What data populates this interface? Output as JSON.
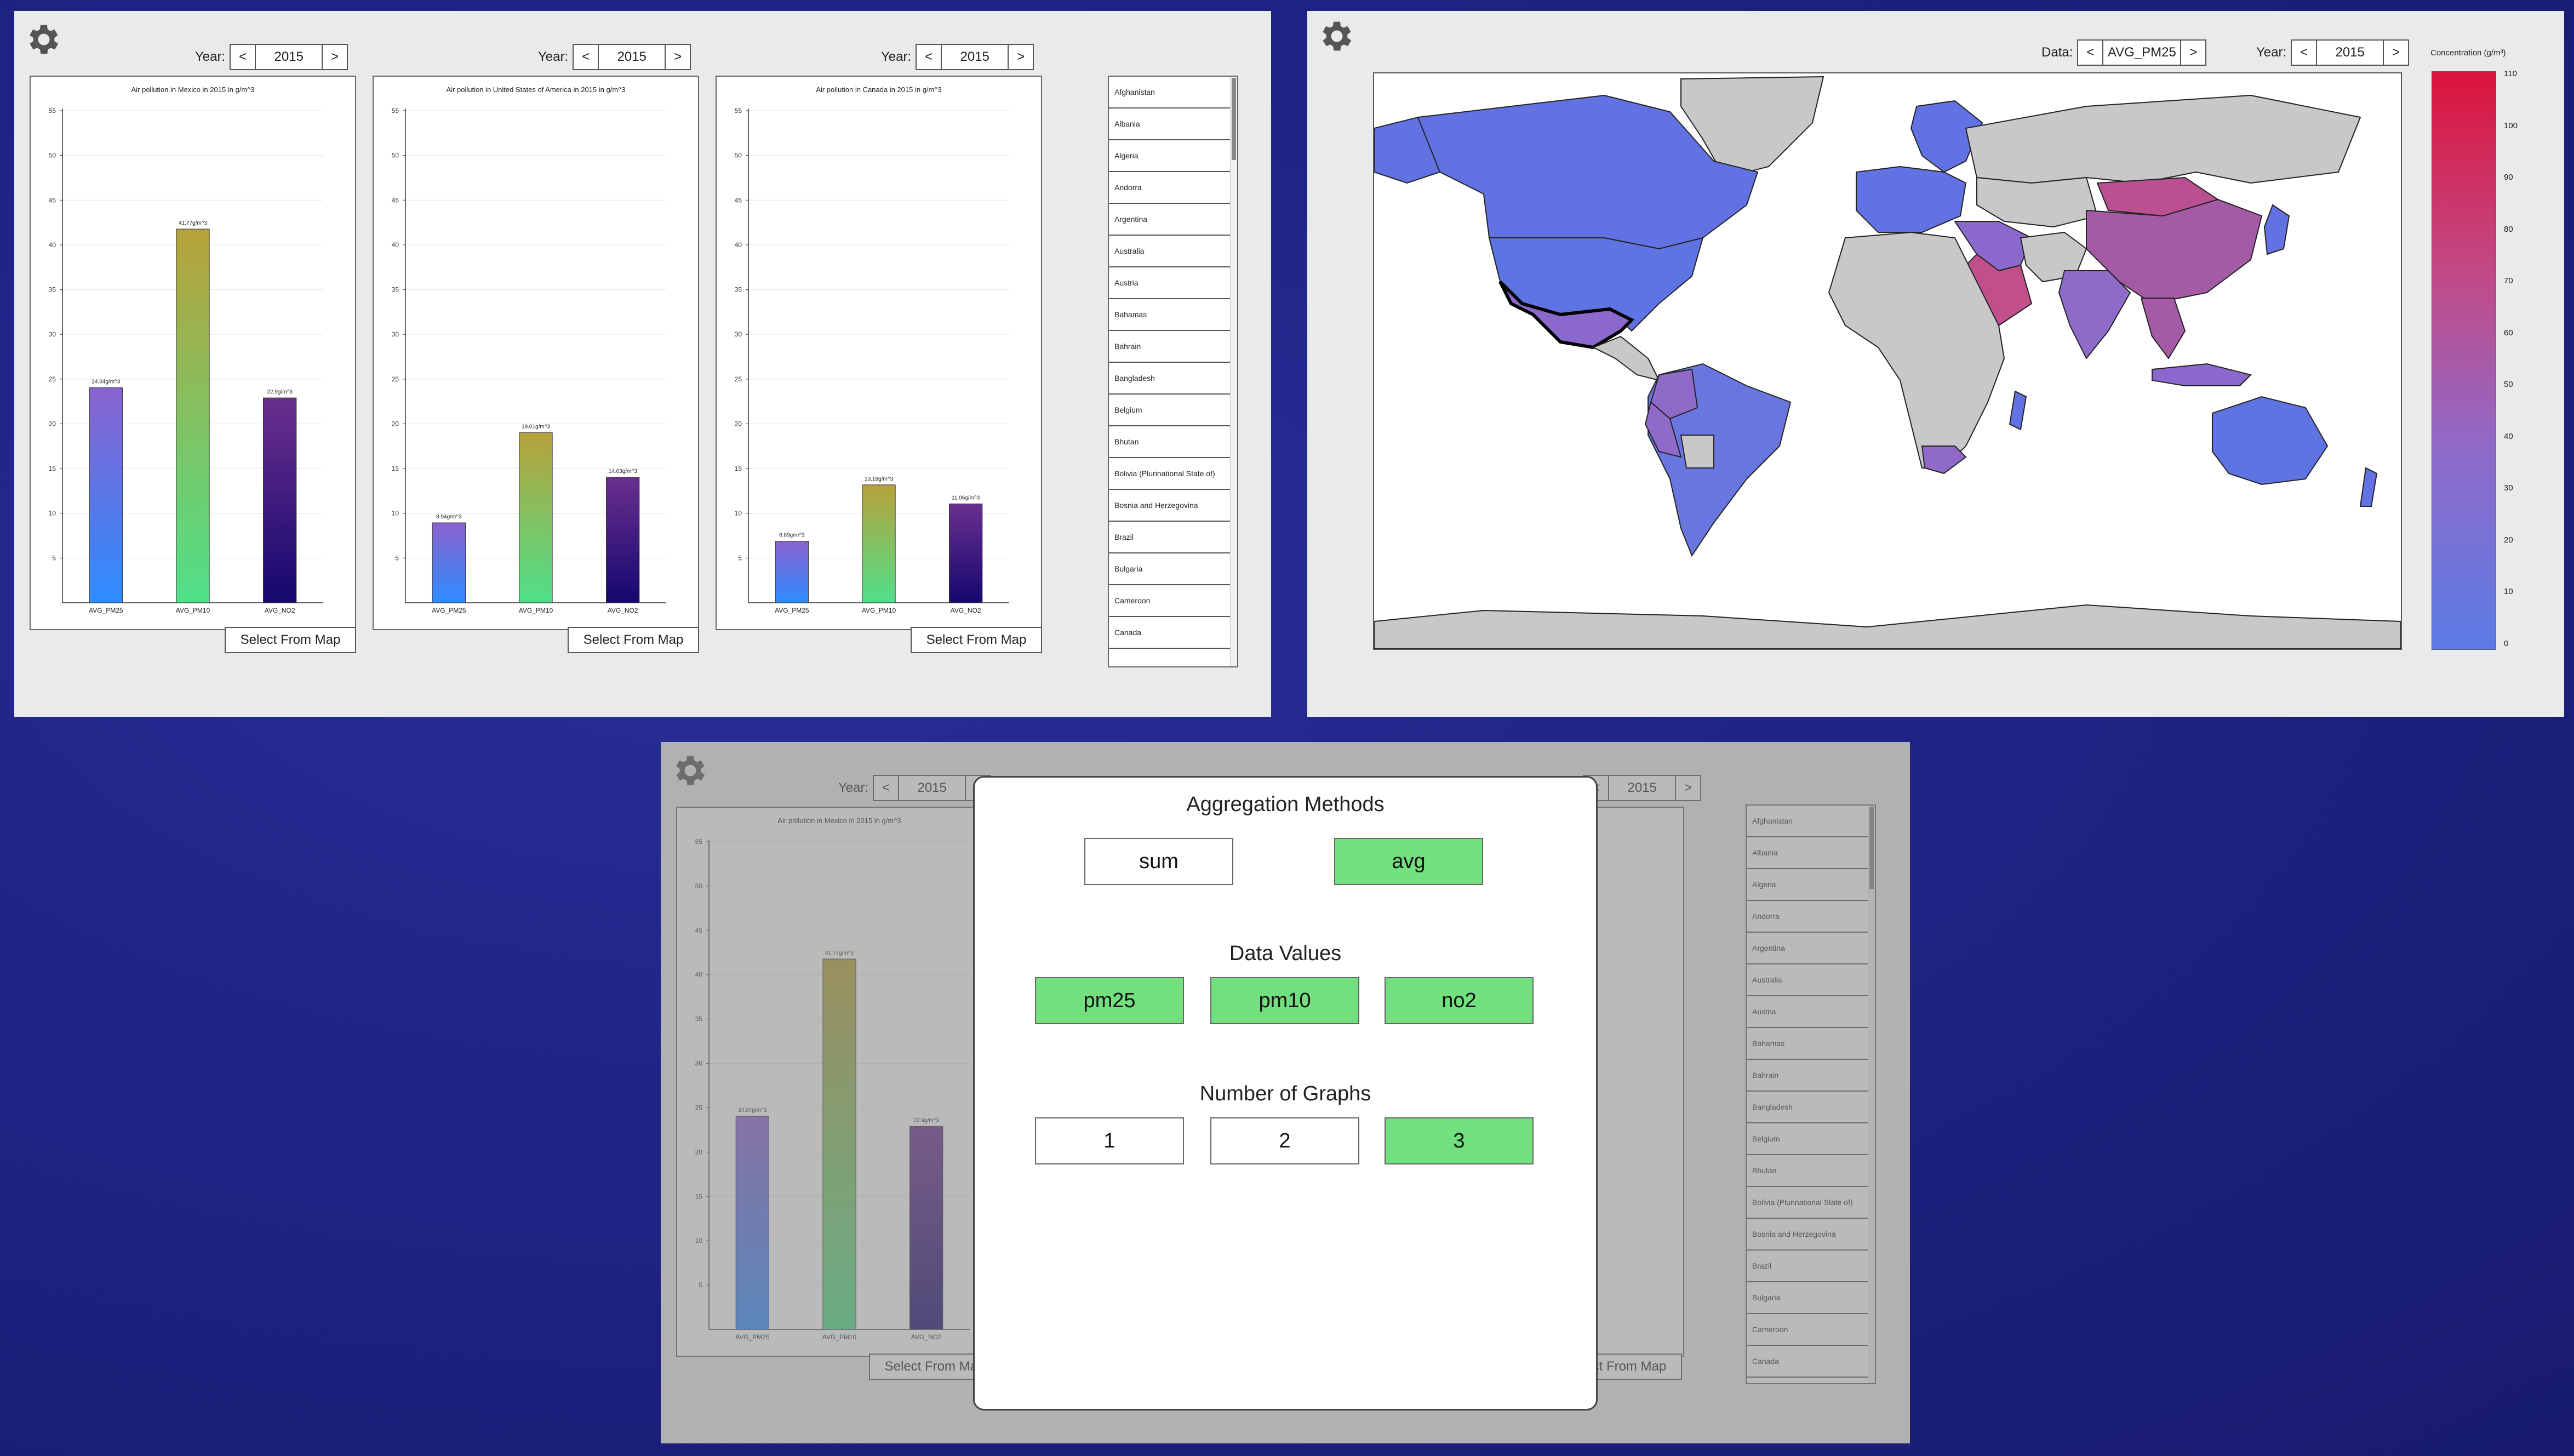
{
  "top_left": {
    "year_label": "Year:",
    "prev": "<",
    "next": ">",
    "select_button": "Select From Map",
    "unit_axis_ticks": [
      "5",
      "10",
      "15",
      "20",
      "25",
      "30",
      "35",
      "40",
      "45",
      "50",
      "55"
    ],
    "countries": [
      "Afghanistan",
      "Albania",
      "Algeria",
      "Andorra",
      "Argentina",
      "Australia",
      "Austria",
      "Bahamas",
      "Bahrain",
      "Bangladesh",
      "Belgium",
      "Bhutan",
      "Bolivia (Plurinational State of)",
      "Bosnia and Herzegovina",
      "Brazil",
      "Bulgaria",
      "Cameroon",
      "Canada"
    ]
  },
  "chart_data": [
    {
      "type": "bar",
      "title": "Air pollution in Mexico in 2015 in g/m^3",
      "year": "2015",
      "categories": [
        "AVG_PM25",
        "AVG_PM10",
        "AVG_NO2"
      ],
      "values": [
        24.04,
        41.77,
        22.9
      ],
      "data_labels": [
        "24.04g/m^3",
        "41.77g/m^3",
        "22.9g/m^3"
      ],
      "ylim": [
        0,
        55
      ],
      "grid": true
    },
    {
      "type": "bar",
      "title": "Air pollution in United States of America in 2015 in g/m^3",
      "year": "2015",
      "categories": [
        "AVG_PM25",
        "AVG_PM10",
        "AVG_NO2"
      ],
      "values": [
        8.94,
        19.01,
        14.03
      ],
      "data_labels": [
        "8.94g/m^3",
        "19.01g/m^3",
        "14.03g/m^3"
      ],
      "ylim": [
        0,
        55
      ],
      "grid": true
    },
    {
      "type": "bar",
      "title": "Air pollution in Canada in 2015 in g/m^3",
      "year": "2015",
      "categories": [
        "AVG_PM25",
        "AVG_PM10",
        "AVG_NO2"
      ],
      "values": [
        6.89,
        13.18,
        11.06
      ],
      "data_labels": [
        "6.89g/m^3",
        "13.18g/m^3",
        "11.06g/m^3"
      ],
      "ylim": [
        0,
        55
      ],
      "grid": true
    }
  ],
  "top_right": {
    "data_label": "Data:",
    "data_value": "AVG_PM25",
    "year_label": "Year:",
    "year_value": "2015",
    "prev": "<",
    "next": ">",
    "legend_title": "Concentration (g/m³)",
    "legend_ticks": [
      "110",
      "100",
      "90",
      "80",
      "70",
      "60",
      "50",
      "40",
      "30",
      "20",
      "10",
      "0"
    ]
  },
  "modal": {
    "agg_title": "Aggregation Methods",
    "agg_options": [
      {
        "label": "sum",
        "selected": false
      },
      {
        "label": "avg",
        "selected": true
      }
    ],
    "data_title": "Data Values",
    "data_options": [
      {
        "label": "pm25",
        "selected": true
      },
      {
        "label": "pm10",
        "selected": true
      },
      {
        "label": "no2",
        "selected": true
      }
    ],
    "graphs_title": "Number of Graphs",
    "graph_options": [
      {
        "label": "1",
        "selected": false
      },
      {
        "label": "2",
        "selected": false
      },
      {
        "label": "3",
        "selected": true
      }
    ]
  },
  "colors": {
    "page_bg": "#1f2385",
    "selected": "#72e07f",
    "map_land": "#c8c8c8",
    "map_low": "#5b7be5",
    "map_high": "#dc143c"
  }
}
